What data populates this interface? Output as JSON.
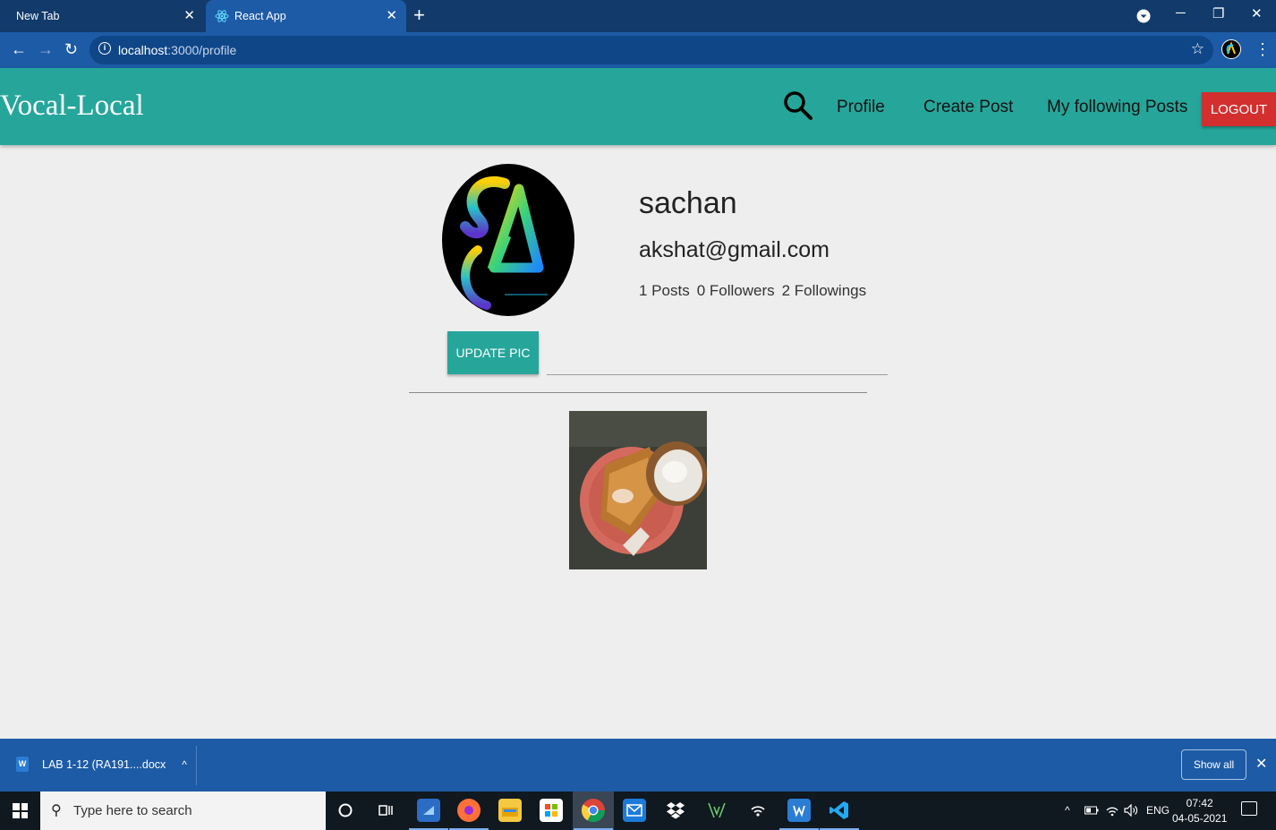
{
  "browser": {
    "tabs": [
      {
        "title": "New Tab",
        "active": false
      },
      {
        "title": "React App",
        "active": true
      }
    ],
    "new_tab_label": "+",
    "url_host": "localhost",
    "url_path": ":3000/profile"
  },
  "app": {
    "brand": "Vocal-Local",
    "nav": {
      "profile": "Profile",
      "create_post": "Create Post",
      "following": "My following Posts",
      "logout": "LOGOUT"
    },
    "colors": {
      "primary": "#26a69a",
      "logout": "#d32f2f"
    }
  },
  "profile": {
    "name": "sachan",
    "email": "akshat@gmail.com",
    "posts": "1 Posts",
    "followers": "0 Followers",
    "followings": "2 Followings",
    "update_pic_label": "UPDATE PIC"
  },
  "posts": [
    {
      "image_desc": "food-photo"
    }
  ],
  "downloads": {
    "item": "LAB 1-12 (RA191....docx",
    "show_all": "Show all"
  },
  "taskbar": {
    "search_placeholder": "Type here to search",
    "language": "ENG",
    "time": "07:42",
    "date": "04-05-2021"
  }
}
